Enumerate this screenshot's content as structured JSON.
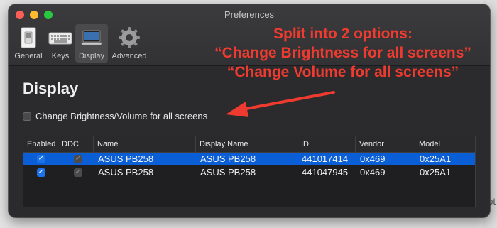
{
  "backdrop": {
    "text": "pt"
  },
  "window": {
    "title": "Preferences"
  },
  "toolbar": {
    "items": [
      {
        "label": "General",
        "icon": "switch-icon",
        "selected": false
      },
      {
        "label": "Keys",
        "icon": "keyboard-icon",
        "selected": false
      },
      {
        "label": "Display",
        "icon": "laptop-display-icon",
        "selected": true
      },
      {
        "label": "Advanced",
        "icon": "gear-icon",
        "selected": false
      }
    ]
  },
  "section": {
    "title": "Display",
    "checkbox_label": "Change Brightness/Volume for all screens",
    "checkbox_checked": false
  },
  "table": {
    "columns": [
      "Enabled",
      "DDC",
      "Name",
      "Display Name",
      "ID",
      "Vendor",
      "Model"
    ],
    "rows": [
      {
        "enabled": true,
        "ddc": true,
        "name": "ASUS PB258",
        "display_name": "ASUS PB258",
        "id": "441017414",
        "vendor": "0x469",
        "model": "0x25A1",
        "selected": true
      },
      {
        "enabled": true,
        "ddc": true,
        "name": "ASUS PB258",
        "display_name": "ASUS PB258",
        "id": "441047945",
        "vendor": "0x469",
        "model": "0x25A1",
        "selected": false
      }
    ]
  },
  "annotation": {
    "lines": [
      "Split into 2 options:",
      "“Change Brightness for all screens”",
      "“Change Volume for all screens”"
    ],
    "color": "#ef3b2f"
  },
  "colors": {
    "window_bg": "#2b2b2d",
    "selection": "#0a5fd6",
    "checkbox_on": "#1b72ea"
  }
}
